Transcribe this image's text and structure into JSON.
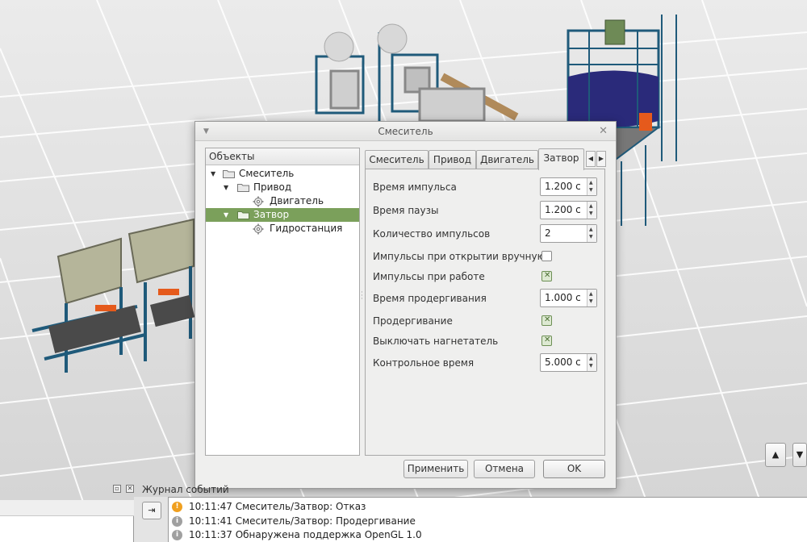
{
  "dialog": {
    "title": "Смеситель",
    "tree_header": "Объекты",
    "tree": [
      {
        "label": "Смеситель",
        "icon": "folder-icon",
        "expanded": true
      },
      {
        "label": "Привод",
        "icon": "folder-icon",
        "expanded": true
      },
      {
        "label": "Двигатель",
        "icon": "gear-icon"
      },
      {
        "label": "Затвор",
        "icon": "folder-icon",
        "expanded": true,
        "selected": true
      },
      {
        "label": "Гидростанция",
        "icon": "gear-icon"
      }
    ],
    "tabs": [
      "Смеситель",
      "Привод",
      "Двигатель",
      "Затвор"
    ],
    "active_tab": "Затвор",
    "tab_prev": "◀",
    "tab_next": "▶",
    "properties": [
      {
        "label": "Время импульса",
        "type": "spin",
        "value": "1.200 с"
      },
      {
        "label": "Время паузы",
        "type": "spin",
        "value": "1.200 с"
      },
      {
        "label": "Количество импульсов",
        "type": "spin",
        "value": "2"
      },
      {
        "label": "Импульсы при открытии вручную",
        "type": "checkbox",
        "checked": false
      },
      {
        "label": "Импульсы при работе",
        "type": "checkbox",
        "checked": true
      },
      {
        "label": "Время продергивания",
        "type": "spin",
        "value": "1.000 с"
      },
      {
        "label": "Продергивание",
        "type": "checkbox",
        "checked": true
      },
      {
        "label": "Выключать нагнетатель",
        "type": "checkbox",
        "checked": true
      },
      {
        "label": "Контрольное время",
        "type": "spin",
        "value": "5.000 с"
      }
    ],
    "buttons": {
      "apply": "Применить",
      "cancel": "Отмена",
      "ok": "OK"
    },
    "close_glyph": "✕",
    "menu_glyph": "▼",
    "check_glyph": "✕",
    "spin_up": "▲",
    "spin_down": "▼",
    "expand_glyph": "▼",
    "selection_color": "#7ba05b"
  },
  "event_log": {
    "title": "Журнал событий",
    "entries": [
      {
        "time": "10:11:47",
        "text": "10:11:47 Смеситель/Затвор: Отказ",
        "level": "warning",
        "color": "#f0a020",
        "icon": "!"
      },
      {
        "time": "10:11:41",
        "text": "10:11:41 Смеситель/Затвор: Продергивание",
        "level": "info",
        "color": "#a0a0a0",
        "icon": "i"
      },
      {
        "time": "10:11:37",
        "text": "10:11:37 Обнаружена поддержка OpenGL 1.0",
        "level": "info",
        "color": "#a0a0a0",
        "icon": "i"
      }
    ],
    "export_glyph": "⇥"
  },
  "view_nav": {
    "up": "▲",
    "down": "▼"
  }
}
